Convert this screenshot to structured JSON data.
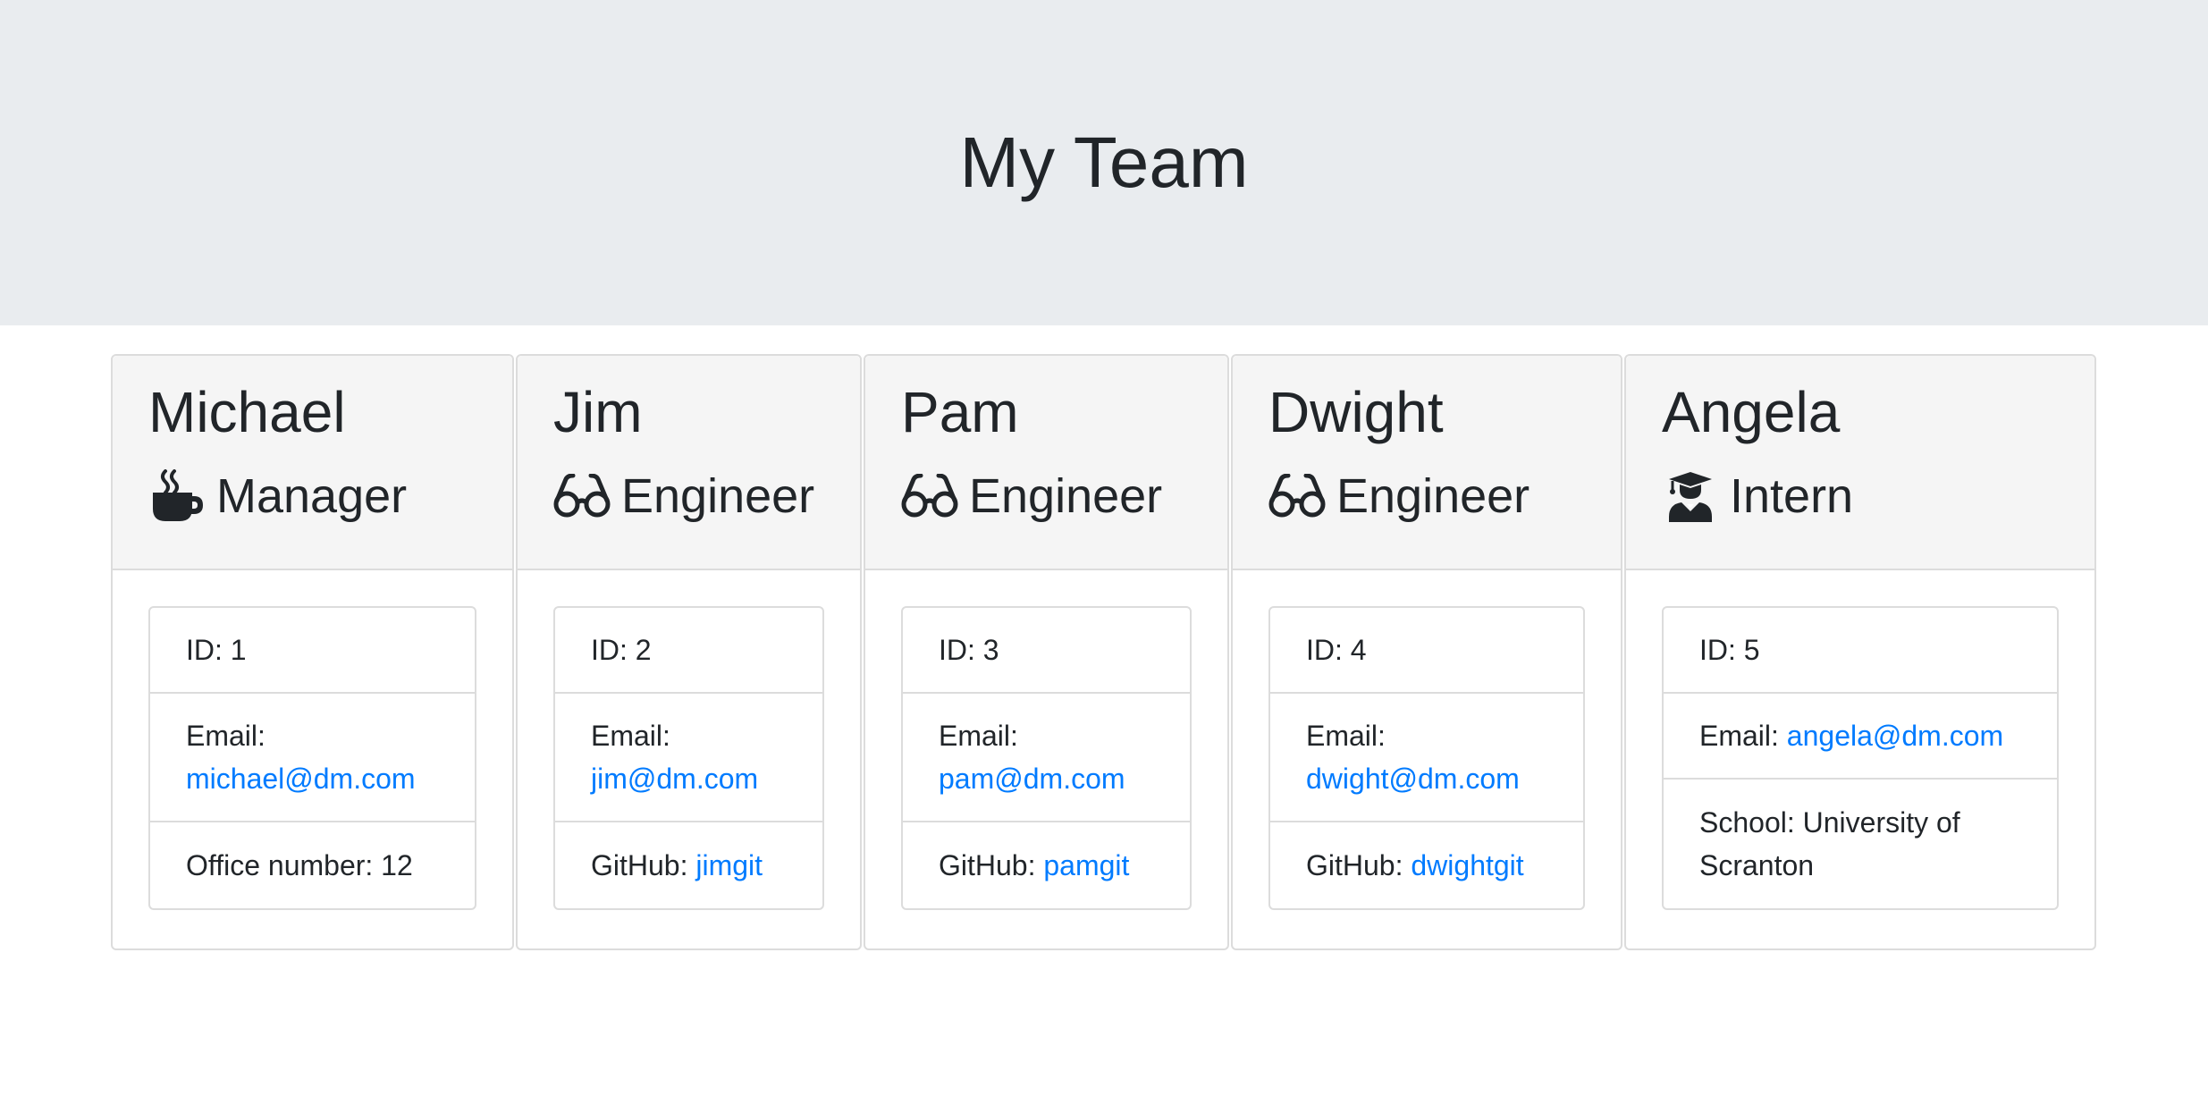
{
  "header": {
    "title": "My Team"
  },
  "colors": {
    "jumbotron": "#e9ecef",
    "link": "#007bff",
    "text": "#212529",
    "card_header": "#f5f5f5"
  },
  "employees": [
    {
      "name": "Michael",
      "role": "Manager",
      "icon": "coffee-mug-icon",
      "id_label": "ID: 1",
      "email_label": "Email:",
      "email": "michael@dm.com",
      "extra_label": "Office number: 12",
      "extra_value": ""
    },
    {
      "name": "Jim",
      "role": "Engineer",
      "icon": "glasses-icon",
      "id_label": "ID: 2",
      "email_label": "Email:",
      "email": "jim@dm.com",
      "extra_label": "GitHub:",
      "extra_value": "jimgit"
    },
    {
      "name": "Pam",
      "role": "Engineer",
      "icon": "glasses-icon",
      "id_label": "ID: 3",
      "email_label": "Email:",
      "email": "pam@dm.com",
      "extra_label": "GitHub:",
      "extra_value": "pamgit"
    },
    {
      "name": "Dwight",
      "role": "Engineer",
      "icon": "glasses-icon",
      "id_label": "ID: 4",
      "email_label": "Email:",
      "email": "dwight@dm.com",
      "extra_label": "GitHub:",
      "extra_value": "dwightgit"
    },
    {
      "name": "Angela",
      "role": "Intern",
      "icon": "graduate-icon",
      "id_label": "ID: 5",
      "email_label": "Email:",
      "email": "angela@dm.com",
      "extra_label": "School: University of Scranton",
      "extra_value": ""
    }
  ]
}
